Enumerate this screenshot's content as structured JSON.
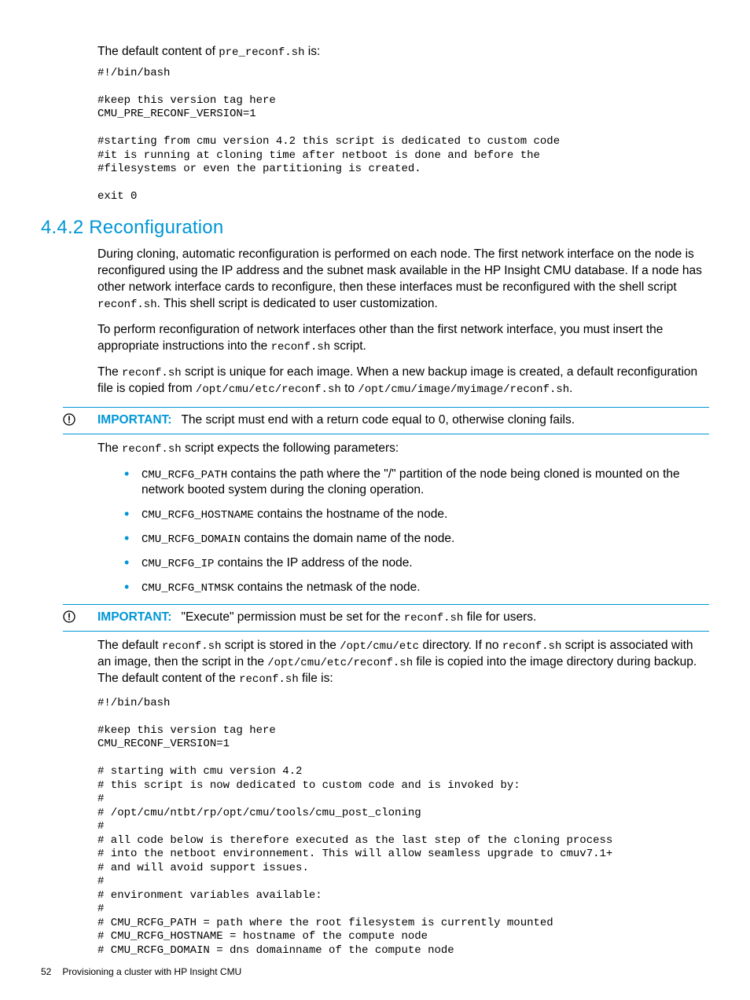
{
  "intro": {
    "pre": "The default content of ",
    "file": "pre_reconf.sh",
    "post": " is:"
  },
  "code1": "#!/bin/bash\n\n#keep this version tag here\nCMU_PRE_RECONF_VERSION=1\n\n#starting from cmu version 4.2 this script is dedicated to custom code\n#it is running at cloning time after netboot is done and before the\n#filesystems or even the partitioning is created.\n\nexit 0",
  "section": {
    "number": "4.4.2",
    "title": "Reconfiguration"
  },
  "p1a": "During cloning, automatic reconfiguration is performed on each node. The first network interface on the node is reconfigured using the IP address and the subnet mask available in the HP Insight CMU database. If a node has other network interface cards to reconfigure, then these interfaces must be reconfigured with the shell script ",
  "p1b": "reconf.sh",
  "p1c": ". This shell script is dedicated to user customization.",
  "p2a": "To perform reconfiguration of network interfaces other than the first network interface, you must insert the appropriate instructions into the ",
  "p2b": "reconf.sh",
  "p2c": " script.",
  "p3a": "The ",
  "p3b": "reconf.sh",
  "p3c": " script is unique for each image. When a new backup image is created, a default reconfiguration file is copied from ",
  "p3d": "/opt/cmu/etc/reconf.sh",
  "p3e": " to ",
  "p3f": "/opt/cmu/image/myimage/reconf.sh",
  "p3g": ".",
  "imp1_label": "IMPORTANT:",
  "imp1_text": "The script must end with a return code equal to 0, otherwise cloning fails.",
  "p4a": "The ",
  "p4b": "reconf.sh",
  "p4c": " script expects the following parameters:",
  "params": [
    {
      "var": "CMU_RCFG_PATH",
      "desc": " contains the path where the \"/\" partition of the node being cloned is mounted on the network booted system during the cloning operation."
    },
    {
      "var": "CMU_RCFG_HOSTNAME",
      "desc": " contains the hostname of the node."
    },
    {
      "var": "CMU_RCFG_DOMAIN",
      "desc": " contains the domain name of the node."
    },
    {
      "var": "CMU_RCFG_IP",
      "desc": " contains the IP address of the node."
    },
    {
      "var": "CMU_RCFG_NTMSK",
      "desc": " contains the netmask of the node."
    }
  ],
  "imp2_label": "IMPORTANT:",
  "imp2_a": "\"Execute\" permission must be set for the ",
  "imp2_b": "reconf.sh",
  "imp2_c": " file for users.",
  "p5a": "The default ",
  "p5b": "reconf.sh",
  "p5c": " script is stored in the ",
  "p5d": "/opt/cmu/etc",
  "p5e": " directory. If no ",
  "p5f": "reconf.sh",
  "p5g": " script is associated with an image, then the script in the ",
  "p5h": "/opt/cmu/etc/reconf.sh",
  "p5i": " file is copied into the image directory during backup. The default content of the ",
  "p5j": "reconf.sh",
  "p5k": " file is:",
  "code2": "#!/bin/bash\n\n#keep this version tag here\nCMU_RECONF_VERSION=1\n\n# starting with cmu version 4.2\n# this script is now dedicated to custom code and is invoked by:\n#\n# /opt/cmu/ntbt/rp/opt/cmu/tools/cmu_post_cloning\n#\n# all code below is therefore executed as the last step of the cloning process\n# into the netboot environnement. This will allow seamless upgrade to cmuv7.1+\n# and will avoid support issues.\n#\n# environment variables available:\n#\n# CMU_RCFG_PATH = path where the root filesystem is currently mounted\n# CMU_RCFG_HOSTNAME = hostname of the compute node\n# CMU_RCFG_DOMAIN = dns domainname of the compute node",
  "footer": {
    "page": "52",
    "title": "Provisioning a cluster with HP Insight CMU"
  }
}
